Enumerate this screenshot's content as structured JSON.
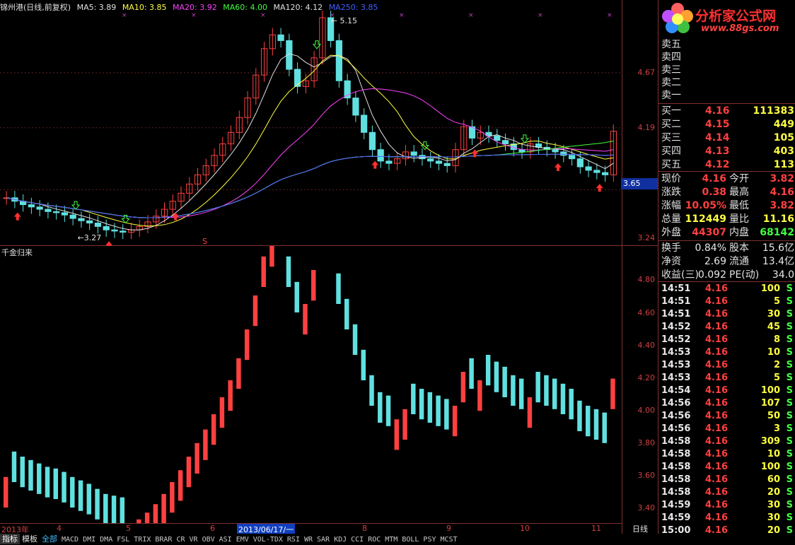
{
  "legend": {
    "title": "锦州港(日线,前复权)",
    "ma": [
      {
        "label": "MA5: 3.89",
        "color": "#e0e0e0"
      },
      {
        "label": "MA10: 3.85",
        "color": "#ffff40"
      },
      {
        "label": "MA20: 3.92",
        "color": "#ff40ff"
      },
      {
        "label": "MA60: 4.00",
        "color": "#40ff40"
      },
      {
        "label": "MA120: 4.12",
        "color": "#e0e0e0"
      },
      {
        "label": "MA250: 3.85",
        "color": "#4060ff"
      }
    ]
  },
  "price_axis_top": [
    "4.67",
    "4.19",
    "3.65",
    "3.24"
  ],
  "price_axis_bottom": [
    "4.80",
    "4.60",
    "4.40",
    "4.20",
    "4.00",
    "3.80",
    "3.60",
    "3.40"
  ],
  "current_price_box": "3.65",
  "annotations": {
    "high": "5.15",
    "low": "3.27",
    "marker": "S"
  },
  "indicator_title": "千金归来",
  "x_labels": [
    {
      "text": "2013年",
      "sel": false
    },
    {
      "text": "4",
      "sel": false
    },
    {
      "text": "5",
      "sel": false
    },
    {
      "text": "6",
      "sel": false
    },
    {
      "text": "2013/06/17/一",
      "sel": true
    },
    {
      "text": "8",
      "sel": false
    },
    {
      "text": "9",
      "sel": false
    },
    {
      "text": "10",
      "sel": false
    },
    {
      "text": "11",
      "sel": false
    }
  ],
  "period_label": "日线",
  "logo": {
    "name": "分析家公式网",
    "url": "www.88gs.com"
  },
  "order_book": {
    "sell": [
      {
        "label": "卖五"
      },
      {
        "label": "卖四"
      },
      {
        "label": "卖三"
      },
      {
        "label": "卖二"
      },
      {
        "label": "卖一"
      }
    ],
    "buy": [
      {
        "label": "买一",
        "price": "4.16",
        "vol": "111383"
      },
      {
        "label": "买二",
        "price": "4.15",
        "vol": "449"
      },
      {
        "label": "买三",
        "price": "4.14",
        "vol": "105"
      },
      {
        "label": "买四",
        "price": "4.13",
        "vol": "403"
      },
      {
        "label": "买五",
        "price": "4.12",
        "vol": "113"
      }
    ]
  },
  "quote": [
    {
      "l1": "现价",
      "v1": "4.16",
      "c1": "red",
      "l2": "今开",
      "v2": "3.82",
      "c2": "red"
    },
    {
      "l1": "涨跌",
      "v1": "0.38",
      "c1": "red",
      "l2": "最高",
      "v2": "4.16",
      "c2": "red"
    },
    {
      "l1": "涨幅",
      "v1": "10.05%",
      "c1": "red",
      "l2": "最低",
      "v2": "3.82",
      "c2": "red"
    },
    {
      "l1": "总量",
      "v1": "112449",
      "c1": "yel",
      "l2": "量比",
      "v2": "11.16",
      "c2": "yel"
    },
    {
      "l1": "外盘",
      "v1": "44307",
      "c1": "red",
      "l2": "内盘",
      "v2": "68142",
      "c2": "grn"
    }
  ],
  "fundamentals": [
    {
      "l1": "换手",
      "v1": "0.84%",
      "l2": "股本",
      "v2": "15.6亿"
    },
    {
      "l1": "净资",
      "v1": "2.69",
      "l2": "流通",
      "v2": "13.4亿"
    },
    {
      "l1": "收益(三)",
      "v1": "0.092",
      "l2": "PE(动)",
      "v2": "34.0"
    }
  ],
  "ticks": [
    {
      "t": "14:51",
      "p": "4.16",
      "v": "100",
      "s": "S"
    },
    {
      "t": "14:51",
      "p": "4.16",
      "v": "5",
      "s": "S"
    },
    {
      "t": "14:51",
      "p": "4.16",
      "v": "30",
      "s": "S"
    },
    {
      "t": "14:52",
      "p": "4.16",
      "v": "45",
      "s": "S"
    },
    {
      "t": "14:52",
      "p": "4.16",
      "v": "8",
      "s": "S"
    },
    {
      "t": "14:53",
      "p": "4.16",
      "v": "10",
      "s": "S"
    },
    {
      "t": "14:53",
      "p": "4.16",
      "v": "2",
      "s": "S"
    },
    {
      "t": "14:53",
      "p": "4.16",
      "v": "5",
      "s": "S"
    },
    {
      "t": "14:54",
      "p": "4.16",
      "v": "100",
      "s": "S"
    },
    {
      "t": "14:56",
      "p": "4.16",
      "v": "107",
      "s": "S"
    },
    {
      "t": "14:56",
      "p": "4.16",
      "v": "50",
      "s": "S"
    },
    {
      "t": "14:56",
      "p": "4.16",
      "v": "3",
      "s": "S"
    },
    {
      "t": "14:58",
      "p": "4.16",
      "v": "309",
      "s": "S"
    },
    {
      "t": "14:58",
      "p": "4.16",
      "v": "10",
      "s": "S"
    },
    {
      "t": "14:58",
      "p": "4.16",
      "v": "100",
      "s": "S"
    },
    {
      "t": "14:58",
      "p": "4.16",
      "v": "60",
      "s": "S"
    },
    {
      "t": "14:58",
      "p": "4.16",
      "v": "20",
      "s": "S"
    },
    {
      "t": "14:59",
      "p": "4.16",
      "v": "30",
      "s": "S"
    },
    {
      "t": "14:59",
      "p": "4.16",
      "v": "30",
      "s": "S"
    },
    {
      "t": "15:00",
      "p": "4.16",
      "v": "20",
      "s": "S"
    }
  ],
  "tabs": [
    "指标",
    "模板",
    "全部",
    "MACD",
    "DMI",
    "DMA",
    "FSL",
    "TRIX",
    "BRAR",
    "CR",
    "VR",
    "OBV",
    "ASI",
    "EMV",
    "VOL-TDX",
    "RSI",
    "WR",
    "SAR",
    "KDJ",
    "CCI",
    "ROC",
    "MTM",
    "BOLL",
    "PSY",
    "MCST"
  ],
  "chart_data": {
    "type": "candlestick",
    "series_closes": [
      3.58,
      3.55,
      3.52,
      3.5,
      3.48,
      3.46,
      3.45,
      3.43,
      3.4,
      3.38,
      3.36,
      3.33,
      3.3,
      3.29,
      3.28,
      3.3,
      3.33,
      3.37,
      3.42,
      3.48,
      3.55,
      3.62,
      3.7,
      3.78,
      3.86,
      3.95,
      4.05,
      4.15,
      4.28,
      4.45,
      4.65,
      4.88,
      5.0,
      4.95,
      4.7,
      4.55,
      4.6,
      4.8,
      5.15,
      4.95,
      4.6,
      4.45,
      4.3,
      4.15,
      4.0,
      3.9,
      3.88,
      3.92,
      3.98,
      3.95,
      3.92,
      3.9,
      3.88,
      3.86,
      4.0,
      4.2,
      4.1,
      4.15,
      4.12,
      4.08,
      4.05,
      4.0,
      3.98,
      4.05,
      4.02,
      4.0,
      3.98,
      3.95,
      3.92,
      3.85,
      3.82,
      3.8,
      3.78,
      4.16
    ],
    "ylim_top": [
      3.24,
      5.15
    ],
    "ylim_bottom": [
      3.35,
      4.85
    ]
  }
}
